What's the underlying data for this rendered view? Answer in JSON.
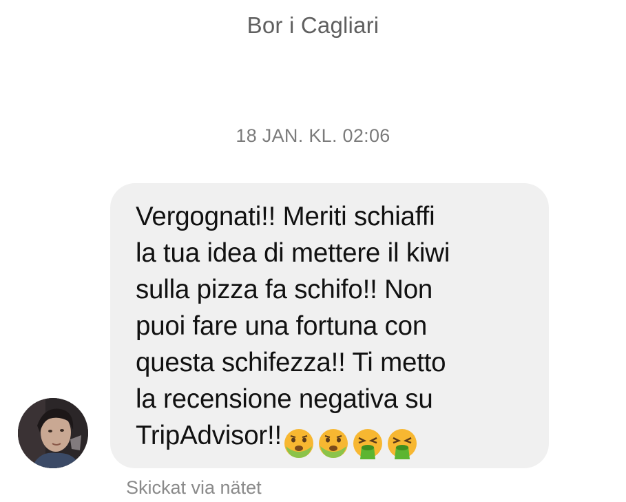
{
  "header": {
    "contact_name": "Bor i Cagliari"
  },
  "thread": {
    "timestamp": "18 JAN. KL. 02:06",
    "message": {
      "text": "Vergognati!! Meriti schiaffi\nla tua idea di mettere il kiwi\nsulla pizza fa schifo!! Non\npuoi fare una fortuna con\nquesta schifezza!! Ti metto\nla recensione negativa su\nTripAdvisor!!",
      "emojis": [
        "nauseated-face",
        "nauseated-face",
        "vomiting-face",
        "vomiting-face"
      ]
    },
    "delivery_note": "Skickat via nätet"
  },
  "colors": {
    "bubble_background": "#f0f0f0",
    "emoji_yellow": "#f7b731",
    "emoji_green": "#7cc242"
  }
}
